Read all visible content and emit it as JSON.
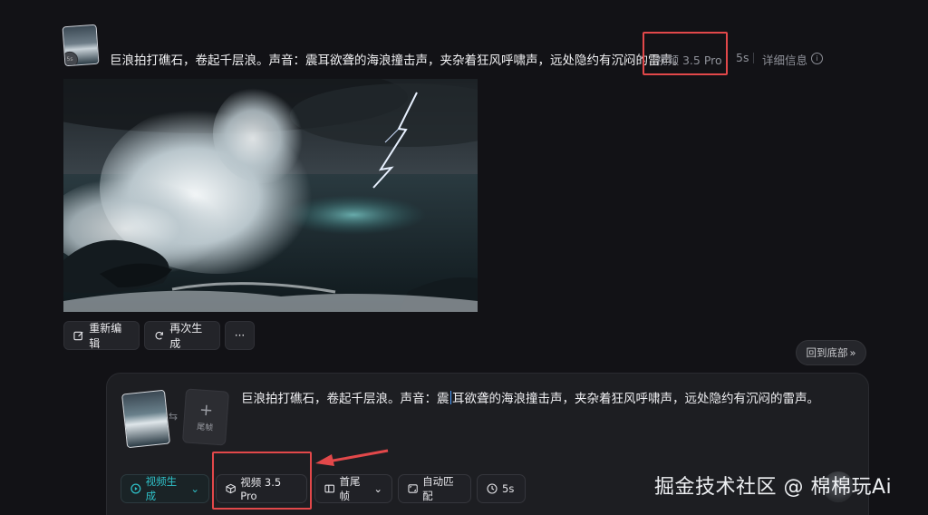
{
  "generation": {
    "prompt": "巨浪拍打礁石，卷起千层浪。声音：震耳欲聋的海浪撞击声，夹杂着狂风呼啸声，远处隐约有沉闷的雷声。",
    "model": "视频 3.5 Pro",
    "duration": "5s",
    "details_label": "详细信息",
    "thumb_badge": "5s"
  },
  "actions": {
    "edit_label": "重新编辑",
    "regenerate_label": "再次生成",
    "more_label": "···"
  },
  "back_to_bottom_label": "回到底部",
  "composer": {
    "prompt_before_caret": "巨浪拍打礁石，卷起千层浪。声音：震",
    "prompt_after_caret": "耳欲聋的海浪撞击声，夹杂着狂风呼啸声，远处隐约有沉闷的雷声。",
    "end_frame_label": "尾帧",
    "swap_symbol": "⇆",
    "mode_label": "视频生成",
    "model_label": "视频 3.5 Pro",
    "frames_label": "首尾帧",
    "auto_match_label": "自动匹配",
    "duration_label": "5s"
  },
  "watermark": "掘金技术社区 @ 棉棉玩Ai",
  "colors": {
    "annotation_red": "#e2484a",
    "accent_teal": "#2fc1c9",
    "caret_blue": "#4b9dff"
  }
}
